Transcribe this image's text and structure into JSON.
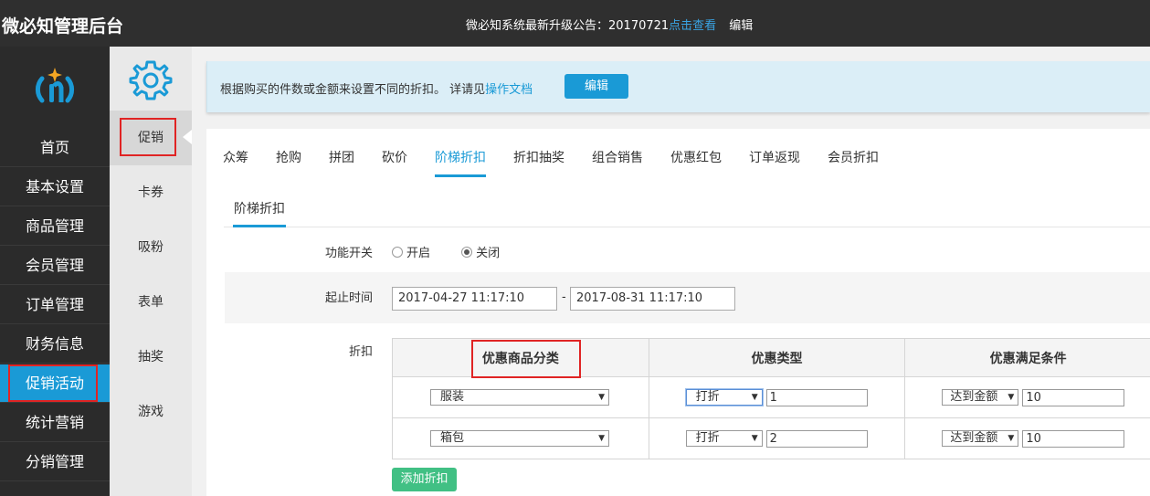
{
  "header": {
    "app_title": "微必知管理后台",
    "notice_prefix": "微必知系统最新升级公告：20170721",
    "notice_link": "点击查看",
    "notice_edit": "编辑"
  },
  "sidebar": {
    "items": [
      {
        "label": "首页"
      },
      {
        "label": "基本设置"
      },
      {
        "label": "商品管理"
      },
      {
        "label": "会员管理"
      },
      {
        "label": "订单管理"
      },
      {
        "label": "财务信息"
      },
      {
        "label": "促销活动",
        "active": true
      },
      {
        "label": "统计营销"
      },
      {
        "label": "分销管理"
      }
    ]
  },
  "subnav": {
    "items": [
      {
        "label": "促销",
        "active": true
      },
      {
        "label": "卡券"
      },
      {
        "label": "吸粉"
      },
      {
        "label": "表单"
      },
      {
        "label": "抽奖"
      },
      {
        "label": "游戏"
      }
    ]
  },
  "info": {
    "text": "根据购买的件数或金额来设置不同的折扣。 详请见",
    "link": "操作文档",
    "edit_label": "编辑"
  },
  "tabs": [
    {
      "label": "众筹"
    },
    {
      "label": "抢购"
    },
    {
      "label": "拼团"
    },
    {
      "label": "砍价"
    },
    {
      "label": "阶梯折扣",
      "active": true
    },
    {
      "label": "折扣抽奖"
    },
    {
      "label": "组合销售"
    },
    {
      "label": "优惠红包"
    },
    {
      "label": "订单返现"
    },
    {
      "label": "会员折扣"
    }
  ],
  "subtab": "阶梯折扣",
  "form": {
    "switch_label": "功能开关",
    "switch_on": "开启",
    "switch_off": "关闭",
    "switch_value": "off",
    "time_label": "起止时间",
    "start_time": "2017-04-27 11:17:10",
    "end_time": "2017-08-31 11:17:10",
    "time_sep": "-",
    "discount_label": "折扣"
  },
  "table": {
    "headers": [
      "优惠商品分类",
      "优惠类型",
      "优惠满足条件"
    ],
    "rows": [
      {
        "category": "服装",
        "type": "打折",
        "type_value": "1",
        "condition": "达到金额",
        "condition_value": "10"
      },
      {
        "category": "箱包",
        "type": "打折",
        "type_value": "2",
        "condition": "达到金额",
        "condition_value": "10"
      }
    ]
  },
  "add_button": "添加折扣",
  "colors": {
    "accent": "#1a9ad6",
    "topbar": "#2f2f2f",
    "sidebar": "#2b2b2b",
    "add_button": "#41c084",
    "highlight": "#e02424"
  }
}
